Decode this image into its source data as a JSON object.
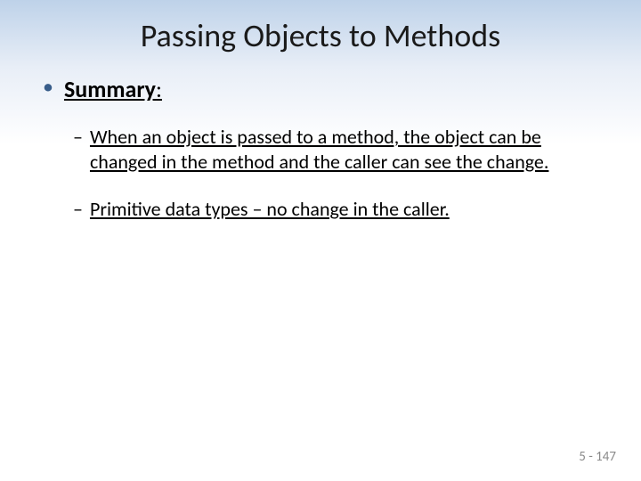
{
  "slide": {
    "title": "Passing Objects to Methods",
    "summary_label": "Summary",
    "summary_colon": ":",
    "points": [
      "When an object is passed to a method, the object can be changed in the method and the caller can see the change.",
      "Primitive data types – no change in the caller."
    ],
    "footer": "5 - 147"
  }
}
